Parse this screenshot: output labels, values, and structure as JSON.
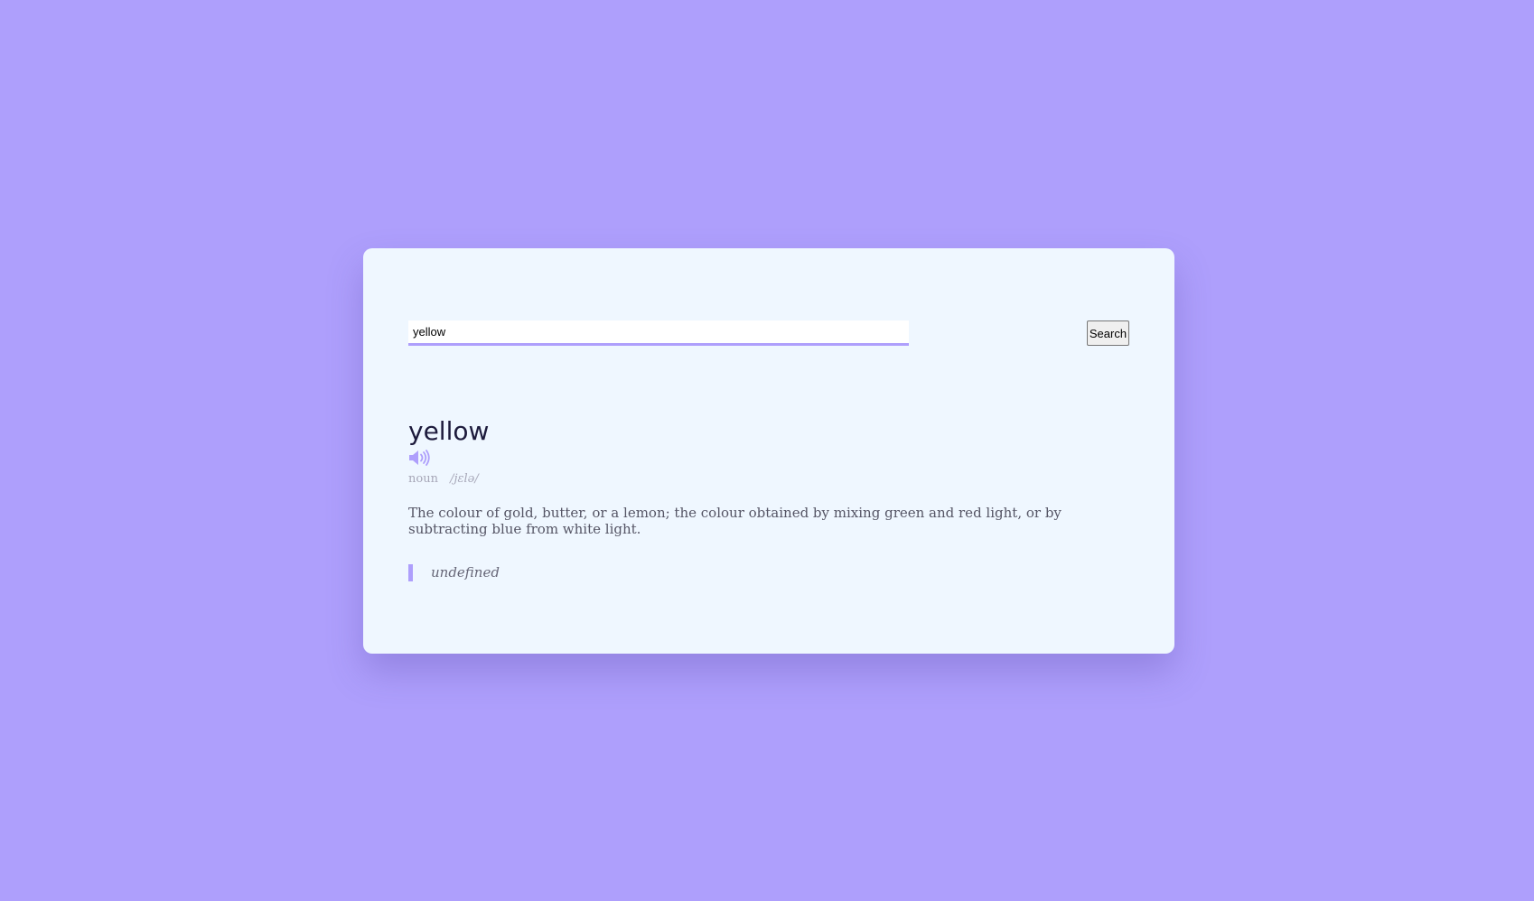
{
  "search": {
    "value": "yellow",
    "button_label": "Search"
  },
  "result": {
    "word": "yellow",
    "part_of_speech": "noun",
    "phonetic": "/jɛlə/",
    "definition": "The colour of gold, butter, or a lemon; the colour obtained by mixing green and red light, or by subtracting blue from white light.",
    "example": "undefined",
    "audio_icon": "speaker-volume-icon"
  },
  "colors": {
    "background": "#ae9ffc",
    "card": "#eff7ff",
    "accent": "#ae9ffc",
    "word_text": "#1d1b3c"
  }
}
